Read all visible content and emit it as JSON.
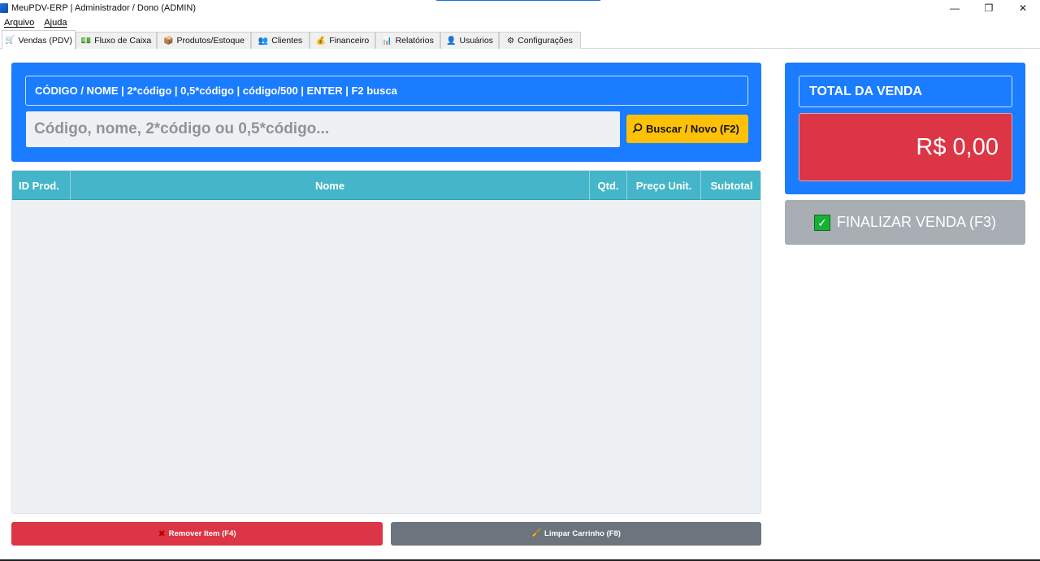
{
  "window": {
    "title": "MeuPDV-ERP  |  Administrador / Dono (ADMIN)",
    "minimize": "—",
    "maximize": "❐",
    "close": "✕"
  },
  "menu": {
    "items": [
      {
        "label": "Arquivo"
      },
      {
        "label": "Ajuda"
      }
    ]
  },
  "tabs": [
    {
      "label": "Vendas (PDV)",
      "icon": "cart-icon",
      "glyph": "🛒"
    },
    {
      "label": "Fluxo de Caixa",
      "icon": "cash-icon",
      "glyph": "💵"
    },
    {
      "label": "Produtos/Estoque",
      "icon": "box-icon",
      "glyph": "📦"
    },
    {
      "label": "Clientes",
      "icon": "people-icon",
      "glyph": "👥"
    },
    {
      "label": "Financeiro",
      "icon": "moneybag-icon",
      "glyph": "💰"
    },
    {
      "label": "Relatórios",
      "icon": "chart-icon",
      "glyph": "📊"
    },
    {
      "label": "Usuários",
      "icon": "user-icon",
      "glyph": "👤"
    },
    {
      "label": "Configurações",
      "icon": "gear-icon",
      "glyph": "⚙"
    }
  ],
  "search": {
    "hint": "CÓDIGO / NOME  |  2*código  |  0,5*código  |  código/500  |  ENTER  |  F2 busca",
    "placeholder": "Código, nome, 2*código ou 0,5*código...",
    "value": "",
    "button_label": "Buscar / Novo (F2)",
    "button_icon": "magnifier-icon"
  },
  "cart": {
    "columns": [
      "ID Prod.",
      "Nome",
      "Qtd.",
      "Preço Unit.",
      "Subtotal"
    ],
    "rows": []
  },
  "actions": {
    "remove_label": "Remover Item (F4)",
    "remove_icon": "x-icon",
    "clear_label": "Limpar Carrinho (F8)",
    "clear_icon": "broom-icon"
  },
  "total": {
    "label": "TOTAL DA VENDA",
    "value": "R$ 0,00"
  },
  "finalize": {
    "label": "FINALIZAR VENDA (F3)",
    "icon": "check-icon"
  },
  "colors": {
    "primary": "#1a7cff",
    "danger": "#dc3545",
    "warning": "#ffc107",
    "secondary": "#6c757d",
    "info": "#45b6c9",
    "disabled": "#a8aeb3"
  }
}
